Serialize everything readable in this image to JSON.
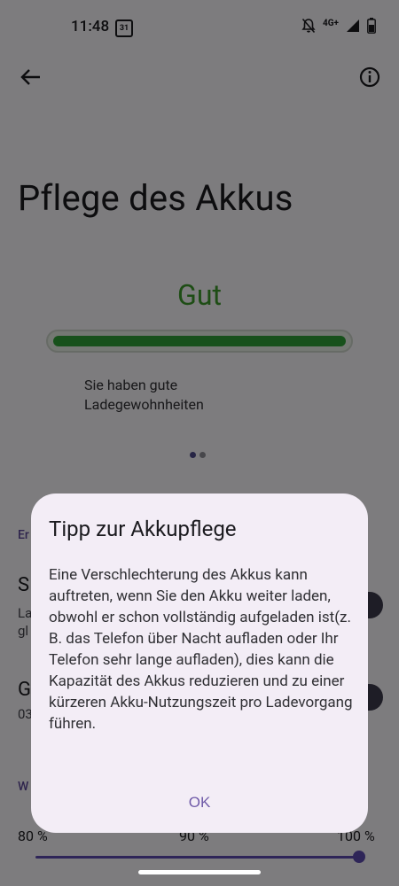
{
  "status_bar": {
    "time": "11:48",
    "calendar_day": "31",
    "network": "4G+"
  },
  "page": {
    "title": "Pflege des Akkus",
    "status_word": "Gut",
    "status_description": "Sie haben gute\nLadegewohnheiten",
    "health_progress": 1.0,
    "pager_total": 2,
    "pager_active": 1
  },
  "settings": {
    "section_1_header": "Er",
    "item_1_title": "S",
    "item_1_sub_line1": "La",
    "item_1_sub_line2": "gl",
    "item_2_title": "G",
    "item_2_sub": "03",
    "section_2_header": "W",
    "slider_labels": [
      "80 %",
      "90 %",
      "100 %"
    ]
  },
  "dialog": {
    "title": "Tipp zur Akkupflege",
    "body": "Eine Verschlechterung des Akkus kann auftreten, wenn Sie den Akku weiter laden, obwohl er schon vollständig aufgeladen ist(z. B. das Telefon über Nacht aufladen oder Ihr Telefon sehr lange aufladen), dies kann die Kapazität des Akkus reduzieren und zu einer kürzeren Akku-Nutzungszeit pro Ladevorgang führen.",
    "ok_label": "OK"
  },
  "colors": {
    "status_good": "#3c9a2b",
    "progress_fill": "#2fa336",
    "accent": "#6f5aa8",
    "dialog_bg": "#f3edf6"
  }
}
